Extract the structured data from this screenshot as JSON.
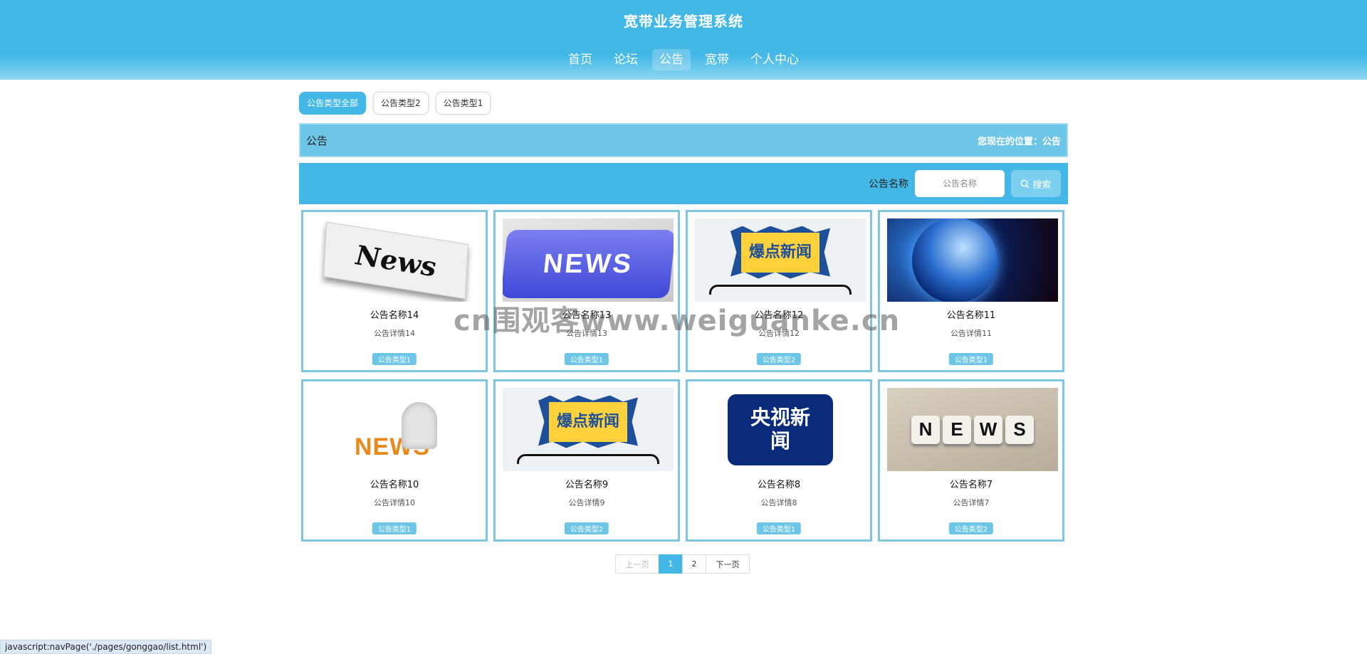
{
  "header": {
    "site_title": "宽带业务管理系统",
    "nav": [
      {
        "label": "首页",
        "active": false
      },
      {
        "label": "论坛",
        "active": false
      },
      {
        "label": "公告",
        "active": true
      },
      {
        "label": "宽带",
        "active": false
      },
      {
        "label": "个人中心",
        "active": false
      }
    ]
  },
  "categories": {
    "items": [
      "公告类型全部",
      "公告类型2",
      "公告类型1"
    ],
    "active_index": 0
  },
  "title_bar": {
    "title": "公告",
    "location": "您现在的位置：公告"
  },
  "search": {
    "label": "公告名称",
    "placeholder": "公告名称",
    "button_label": "搜索"
  },
  "cards": [
    {
      "name": "公告名称14",
      "desc": "公告详情14",
      "tag": "公告类型1",
      "image": "News"
    },
    {
      "name": "公告名称13",
      "desc": "公告详情13",
      "tag": "公告类型1",
      "image": "NEWS"
    },
    {
      "name": "公告名称12",
      "desc": "公告详情12",
      "tag": "公告类型2",
      "image": "爆点新闻"
    },
    {
      "name": "公告名称11",
      "desc": "公告详情11",
      "tag": "公告类型1",
      "image": ""
    },
    {
      "name": "公告名称10",
      "desc": "公告详情10",
      "tag": "公告类型1",
      "image": "NEWS"
    },
    {
      "name": "公告名称9",
      "desc": "公告详情9",
      "tag": "公告类型2",
      "image": "爆点新闻"
    },
    {
      "name": "公告名称8",
      "desc": "公告详情8",
      "tag": "公告类型1",
      "image": "央视新闻"
    },
    {
      "name": "公告名称7",
      "desc": "公告详情7",
      "tag": "公告类型2",
      "image": "NEWS"
    }
  ],
  "pagination": {
    "prev_label": "上一页",
    "pages": [
      "1",
      "2"
    ],
    "current": "1",
    "next_label": "下一页"
  },
  "watermark": "cn围观客www.weiguanke.cn",
  "status_bar": "javascript:navPage('./pages/gonggao/list.html')",
  "colors": {
    "primary": "#43b8e6",
    "title_bar": "#6dc6e6",
    "card_border": "#7cc7df"
  }
}
